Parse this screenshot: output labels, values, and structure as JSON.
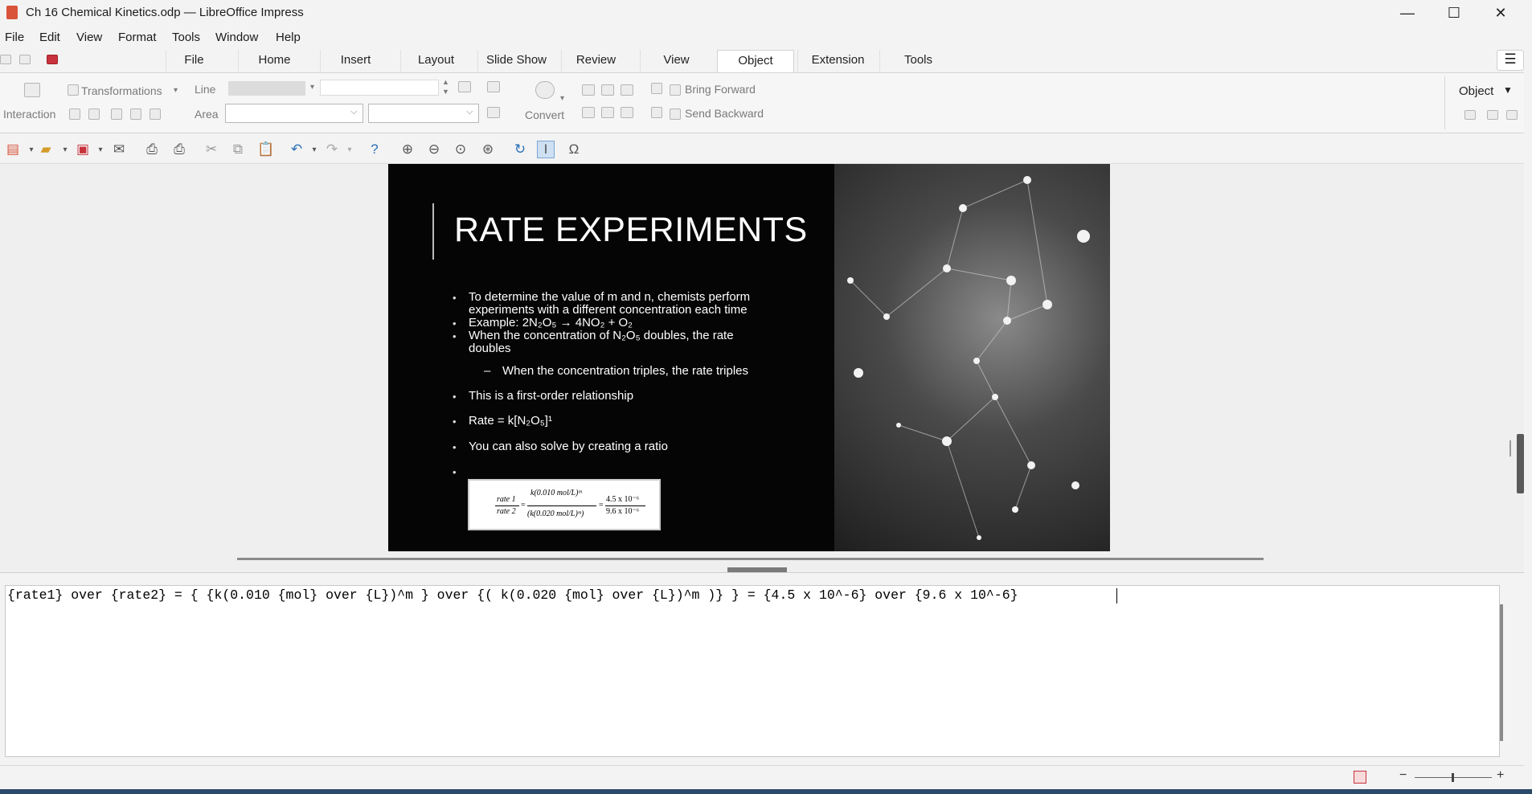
{
  "window": {
    "title": "Ch 16 Chemical Kinetics.odp — LibreOffice Impress",
    "minimize": "—",
    "maximize": "☐",
    "close": "✕"
  },
  "menu": [
    "File",
    "Edit",
    "View",
    "Format",
    "Tools",
    "Window",
    "Help"
  ],
  "tabs": [
    "File",
    "Home",
    "Insert",
    "Layout",
    "Slide Show",
    "Review",
    "View",
    "Object",
    "Extension",
    "Tools"
  ],
  "active_tab": "Object",
  "ribbon": {
    "transformations": "Transformations",
    "interaction": "Interaction",
    "line": "Line",
    "area": "Area",
    "convert": "Convert",
    "bring_forward": "Bring Forward",
    "send_backward": "Send Backward",
    "object_menu": "Object"
  },
  "slide": {
    "title": "RATE EXPERIMENTS",
    "bullets": [
      "To determine the value of m and n, chemists perform",
      "experiments with a different concentration each time",
      "Example: 2N₂O₅ → 4NO₂ + O₂",
      "When the concentration of N₂O₅ doubles, the rate",
      "doubles",
      "When the concentration triples, the rate triples",
      "This is a first-order relationship",
      "Rate = k[N₂O₅]¹",
      "You can also solve by creating a ratio"
    ],
    "sub_dash": "–",
    "formula_parts": {
      "rate1": "rate 1",
      "rate2": "rate 2",
      "num": "k(0.010 mol/L)ᵐ",
      "den": "(k(0.020 mol/L)ᵐ)",
      "r_num": "4.5 x 10⁻⁶",
      "r_den": "9.6 x 10⁻⁶",
      "eq": "="
    }
  },
  "editor": {
    "content": "{rate1} over {rate2} = { {k(0.010 {mol} over {L})^m } over {( k(0.020 {mol} over {L})^m )} } = {4.5 x 10^-6} over {9.6 x 10^-6} "
  },
  "statusbar": {
    "zoom_out": "−",
    "zoom_in": "+"
  }
}
